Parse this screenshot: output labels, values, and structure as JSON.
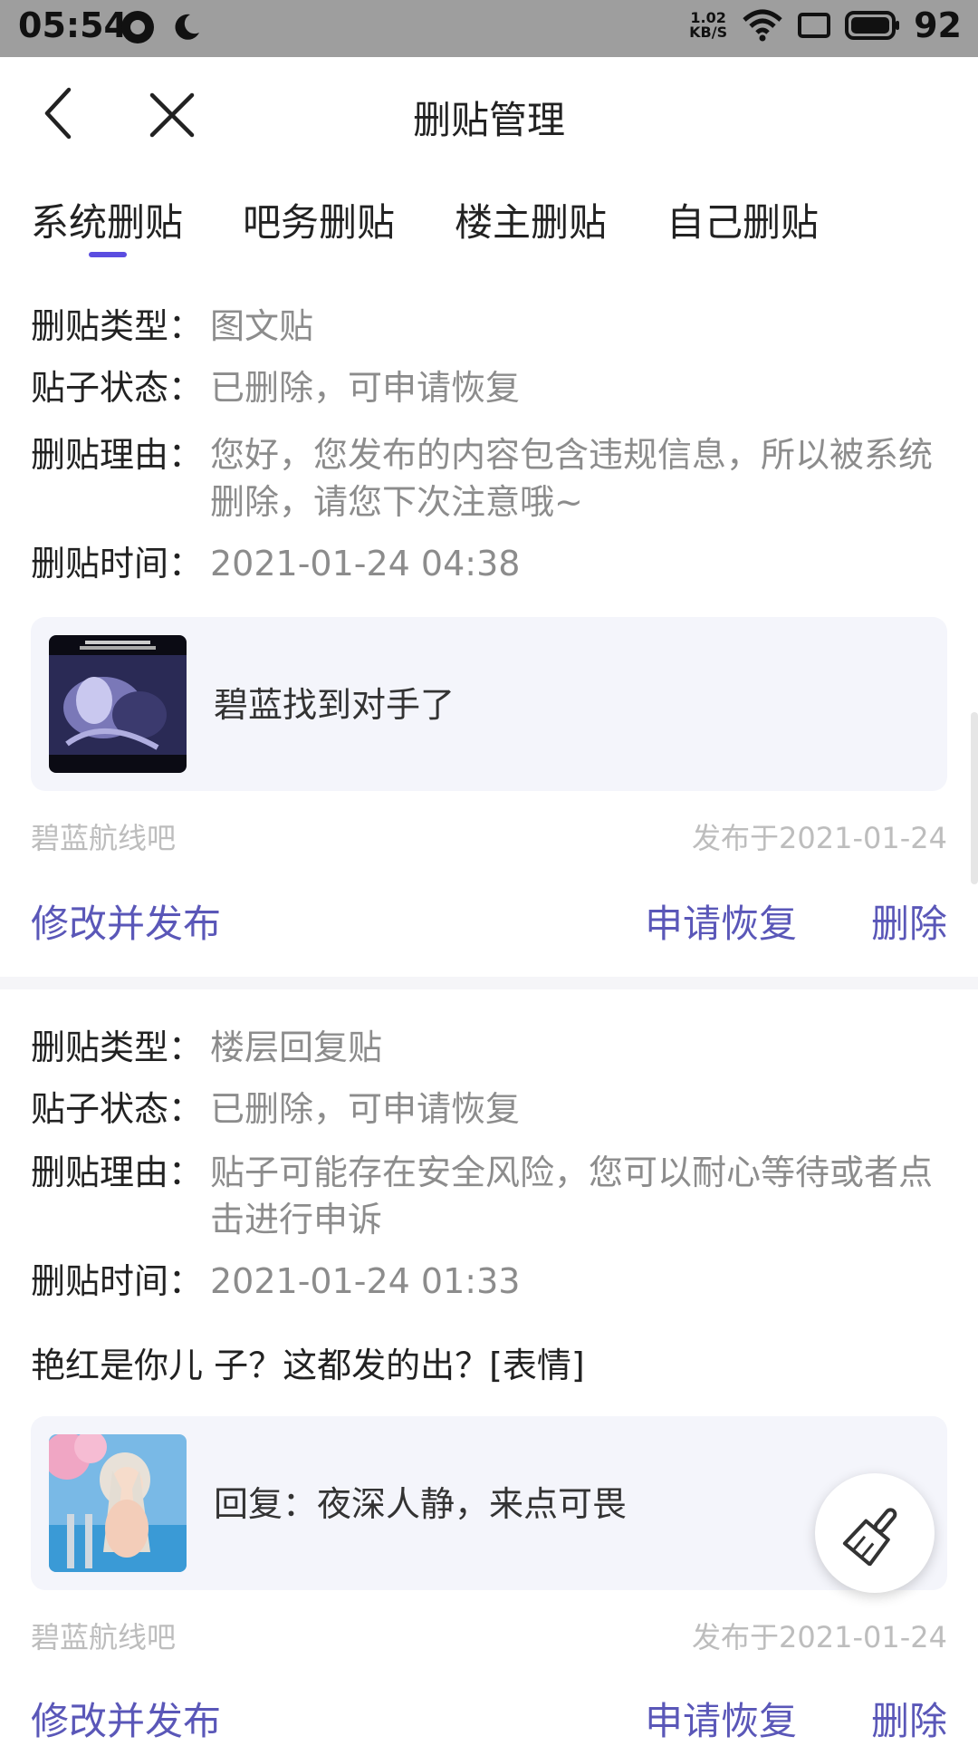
{
  "status_bar": {
    "time": "05:54",
    "net_speed_value": "1.02",
    "net_speed_unit": "KB/S",
    "battery": "92"
  },
  "header": {
    "title": "删贴管理"
  },
  "tabs": [
    {
      "label": "系统删贴",
      "active": true
    },
    {
      "label": "吧务删贴",
      "active": false
    },
    {
      "label": "楼主删贴",
      "active": false
    },
    {
      "label": "自己删贴",
      "active": false
    }
  ],
  "labels": {
    "type": "删贴类型：",
    "status": "贴子状态：",
    "reason": "删贴理由：",
    "time": "删贴时间："
  },
  "records": [
    {
      "type": "图文贴",
      "status": "已删除，可申请恢复",
      "reason": "您好，您发布的内容包含违规信息，所以被系统删除，请您下次注意哦~",
      "time": "2021-01-24 04:38",
      "post_title": "碧蓝找到对手了",
      "forum": "碧蓝航线吧",
      "published": "发布于2021-01-24",
      "action_edit": "修改并发布",
      "action_restore": "申请恢复",
      "action_delete": "删除"
    },
    {
      "type": "楼层回复贴",
      "status": "已删除，可申请恢复",
      "reason": "贴子可能存在安全风险，您可以耐心等待或者点击进行申诉",
      "time": "2021-01-24 01:33",
      "content": "艳红是你儿 子？这都发的出？[表情]",
      "post_title": "回复：夜深人静，来点可畏",
      "forum": "碧蓝航线吧",
      "published": "发布于2021-01-24",
      "action_edit": "修改并发布",
      "action_restore": "申请恢复",
      "action_delete": "删除"
    }
  ],
  "colors": {
    "accent": "#5a57b8",
    "tab_indicator": "#5b4de0",
    "muted": "#8c8c8c"
  }
}
